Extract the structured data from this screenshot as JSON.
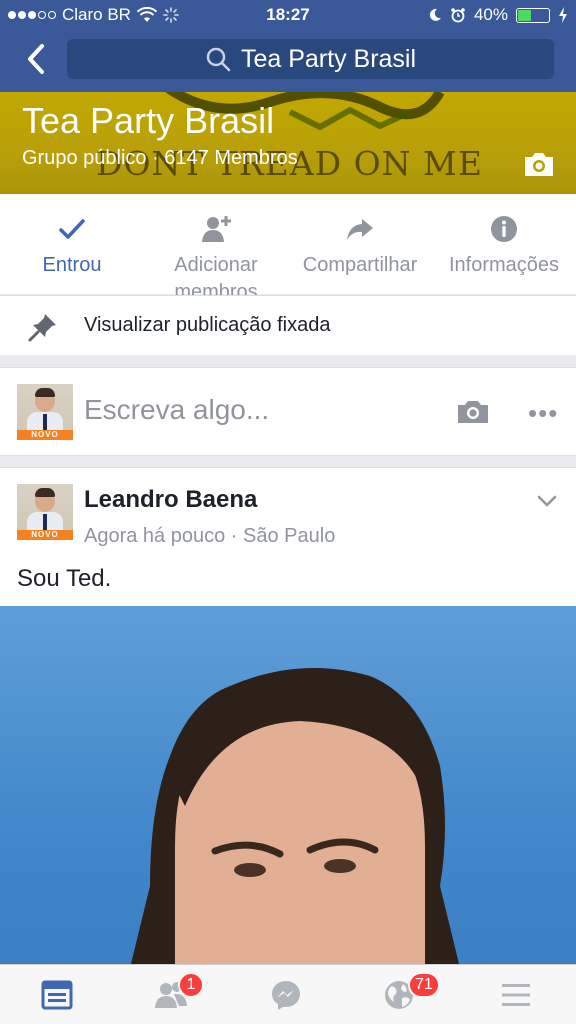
{
  "status_bar": {
    "carrier": "Claro BR",
    "time": "18:27",
    "battery": "40%",
    "battery_level": 0.4
  },
  "nav": {
    "search_text": "Tea Party Brasil"
  },
  "cover": {
    "title": "Tea Party Brasil",
    "subtitle": "Grupo público · 6147 Membros",
    "motto": "DONT TREAD ON ME"
  },
  "actions": [
    {
      "label": "Entrou",
      "icon": "check-icon",
      "active": true
    },
    {
      "label": "Adicionar membros",
      "icon": "add-member-icon"
    },
    {
      "label": "Compartilhar",
      "icon": "share-icon"
    },
    {
      "label": "Informações",
      "icon": "info-icon"
    }
  ],
  "pinned": {
    "label": "Visualizar publicação fixada"
  },
  "composer": {
    "placeholder": "Escreva algo..."
  },
  "avatar_brand": "NOVO",
  "post": {
    "author": "Leandro Baena",
    "time": "Agora há pouco",
    "location": "São Paulo",
    "text": "Sou Ted."
  },
  "tabbar": {
    "friend_requests_badge": "1",
    "notifications_badge": "71"
  },
  "colors": {
    "brand": "#3b5998",
    "accent": "#4267b2",
    "badge": "#fa3e3e",
    "cover": "#b89f0a"
  }
}
